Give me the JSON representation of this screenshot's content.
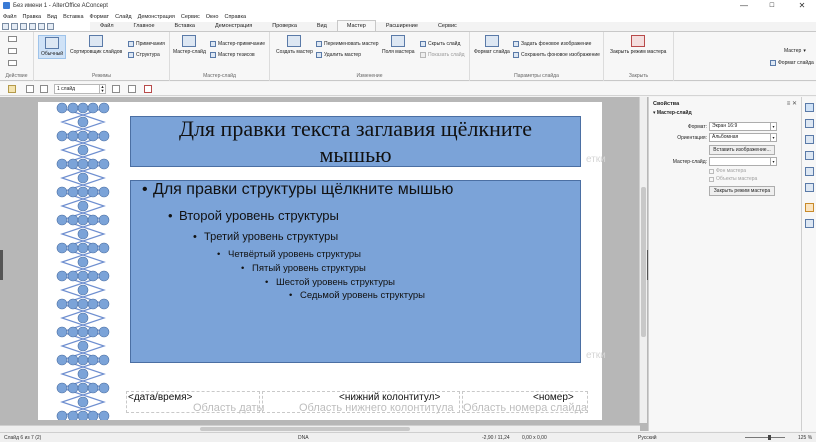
{
  "window": {
    "title": "Без имени 1 - AlterOffice AConcept",
    "minimize": "—",
    "maximize": "☐",
    "close": "✕"
  },
  "menu": [
    "Файл",
    "Правка",
    "Вид",
    "Вставка",
    "Формат",
    "Слайд",
    "Демонстрация",
    "Сервис",
    "Окно",
    "Справка"
  ],
  "tabs": [
    {
      "label": "Файл",
      "active": false
    },
    {
      "label": "Главное",
      "active": false
    },
    {
      "label": "Вставка",
      "active": false
    },
    {
      "label": "Демонстрация",
      "active": false
    },
    {
      "label": "Проверка",
      "active": false
    },
    {
      "label": "Вид",
      "active": false
    },
    {
      "label": "Мастер",
      "active": true
    },
    {
      "label": "Расширение",
      "active": false
    },
    {
      "label": "Сервис",
      "active": false
    }
  ],
  "ribbon": {
    "groups": {
      "actions": "Действие",
      "modes": "Режимы",
      "master_slide": "Мастер-слайд",
      "edit": "Изменение",
      "params": "Параметры слайда",
      "close": "Закрыть"
    },
    "normal": "Обычный",
    "sorter": "Сортировщик слайдов",
    "notes": "Примечания",
    "outline": "Структура",
    "master_slide": "Мастер-слайд",
    "master_notes": "Мастер-примечание",
    "master_handouts": "Мастер тезисов",
    "create_master": "Создать мастер",
    "rename_master": "Переименовать мастер",
    "delete_master": "Удалить мастер",
    "master_fields": "Поля мастера",
    "hide_slide": "Скрыть слайд",
    "show_slide": "Показать слайд",
    "slide_format": "Формат слайда",
    "set_bg": "Задать фоновое изображение",
    "save_bg": "Сохранить фоновое изображение",
    "close_master": "Закрыть режим мастера",
    "right_master": "Мастер",
    "right_format": "Формат слайда"
  },
  "subbar": {
    "slide_count": "1 слайд"
  },
  "slide": {
    "title": "Для правки текста заглавия щёлкните мышью",
    "levels": [
      "Для правки структуры щёлкните мышью",
      "Второй уровень структуры",
      "Третий уровень структуры",
      "Четвёртый уровень структуры",
      "Пятый уровень структуры",
      "Шестой уровень структуры",
      "Седьмой уровень структуры"
    ],
    "watermark": "етки",
    "footer": {
      "date": "<дата/время>",
      "date_area": "Область даты",
      "footer": "<нижний колонтитул>",
      "footer_area": "Область нижнего колонтитула",
      "number": "<номер>",
      "number_area": "Область номера слайда"
    }
  },
  "sidebar": {
    "title": "Свойства",
    "section": "Мастер-слайд",
    "format_label": "Формат:",
    "format_value": "Экран 16:9",
    "orientation_label": "Ориентация:",
    "orientation_value": "Альбомная",
    "insert_image": "Вставить изображение...",
    "master_label": "Мастер-слайд:",
    "master_value": "",
    "bg_master": "Фон мастера",
    "objects_master": "Объекты мастера",
    "close_master": "Закрыть режим мастера"
  },
  "status": {
    "slide": "Слайд 6 из 7 (2)",
    "master": "DNA",
    "coords": "-2,90 / 11,24",
    "size": "0,00 x 0,00",
    "language": "Русский",
    "zoom": "125 %"
  }
}
